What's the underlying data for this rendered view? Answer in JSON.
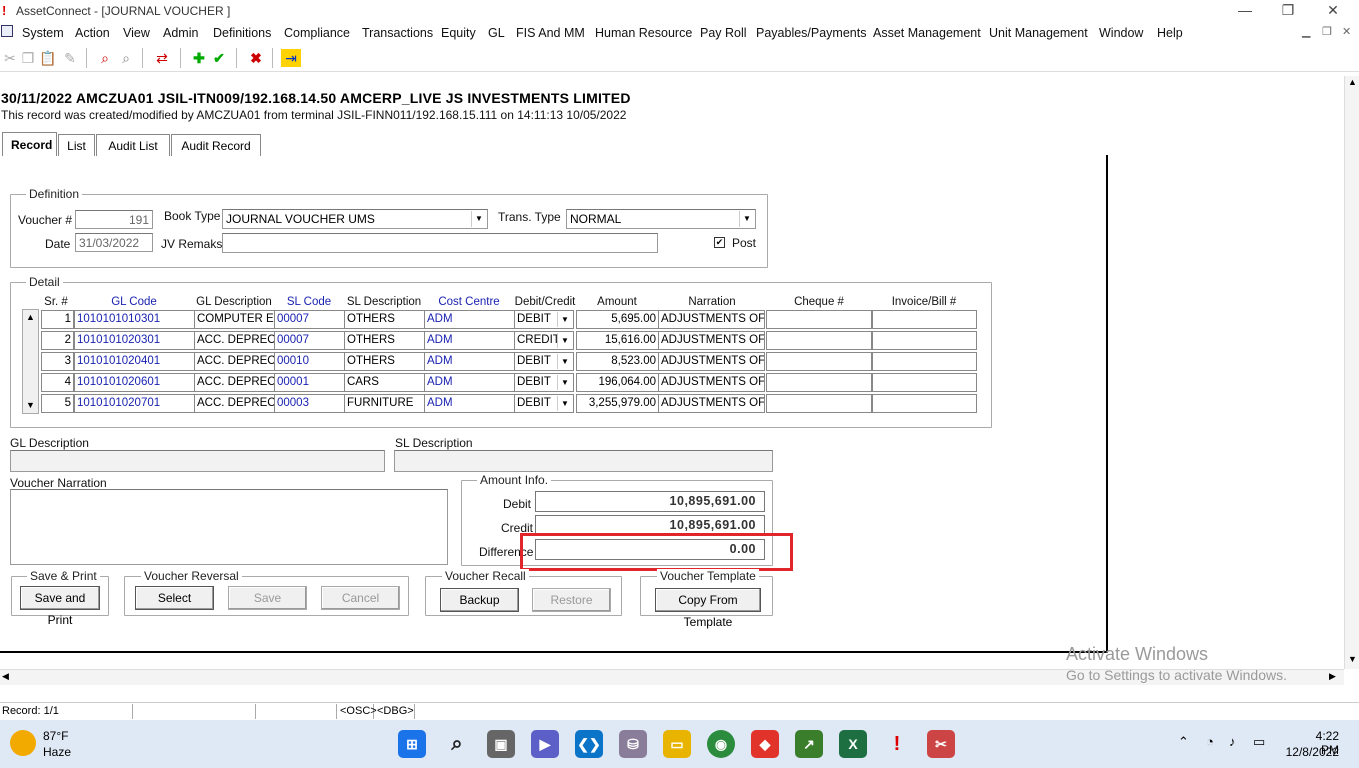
{
  "window": {
    "title": "AssetConnect - [JOURNAL VOUCHER ]"
  },
  "menu": [
    "System",
    "Action",
    "View",
    "Admin",
    "Definitions",
    "Compliance",
    "Transactions",
    "Equity",
    "GL",
    "FIS And MM",
    "Human Resource",
    "Pay Roll",
    "Payables/Payments",
    "Asset Management",
    "Unit Management",
    "Window",
    "Help"
  ],
  "header": {
    "line1": "30/11/2022    AMCZUA01    JSIL-ITN009/192.168.14.50    AMCERP_LIVE    JS INVESTMENTS LIMITED",
    "line2": "This record was created/modified by AMCZUA01 from terminal JSIL-FINN011/192.168.15.111 on 14:11:13 10/05/2022"
  },
  "tabs": [
    "Record",
    "List",
    "Audit List",
    "Audit Record"
  ],
  "definition": {
    "title": "Definition",
    "voucher_label": "Voucher #",
    "voucher_value": "191",
    "book_type_label": "Book Type",
    "book_type_value": "JOURNAL VOUCHER UMS",
    "trans_type_label": "Trans. Type",
    "trans_type_value": "NORMAL",
    "date_label": "Date",
    "date_value": "31/03/2022",
    "jv_remarks_label": "JV Remaks",
    "jv_remarks_value": "",
    "post_label": "Post"
  },
  "detail": {
    "title": "Detail",
    "columns": [
      "Sr. #",
      "GL Code",
      "GL Description",
      "SL Code",
      "SL Description",
      "Cost Centre",
      "Debit/Credit",
      "Amount",
      "Narration",
      "Cheque #",
      "Invoice/Bill #"
    ],
    "rows": [
      {
        "sr": "1",
        "gl": "1010101010301",
        "gld": "COMPUTER E",
        "sl": "00007",
        "sld": "OTHERS",
        "cc": "ADM",
        "dc": "DEBIT",
        "amt": "5,695.00",
        "nar": "ADJUSTMENTS OF",
        "chq": "",
        "inv": ""
      },
      {
        "sr": "2",
        "gl": "1010101020301",
        "gld": "ACC. DEPREC",
        "sl": "00007",
        "sld": "OTHERS",
        "cc": "ADM",
        "dc": "CREDIT",
        "amt": "15,616.00",
        "nar": "ADJUSTMENTS OF",
        "chq": "",
        "inv": ""
      },
      {
        "sr": "3",
        "gl": "1010101020401",
        "gld": "ACC. DEPREC",
        "sl": "00010",
        "sld": "OTHERS",
        "cc": "ADM",
        "dc": "DEBIT",
        "amt": "8,523.00",
        "nar": "ADJUSTMENTS OF",
        "chq": "",
        "inv": ""
      },
      {
        "sr": "4",
        "gl": "1010101020601",
        "gld": "ACC. DEPREC",
        "sl": "00001",
        "sld": "CARS",
        "cc": "ADM",
        "dc": "DEBIT",
        "amt": "196,064.00",
        "nar": "ADJUSTMENTS OF",
        "chq": "",
        "inv": ""
      },
      {
        "sr": "5",
        "gl": "1010101020701",
        "gld": "ACC. DEPREC",
        "sl": "00003",
        "sld": "FURNITURE",
        "cc": "ADM",
        "dc": "DEBIT",
        "amt": "3,255,979.00",
        "nar": "ADJUSTMENTS OF",
        "chq": "",
        "inv": ""
      }
    ]
  },
  "descriptions": {
    "gl_label": "GL Description",
    "sl_label": "SL Description",
    "narration_label": "Voucher Narration"
  },
  "amount_info": {
    "title": "Amount Info.",
    "debit_label": "Debit",
    "debit": "10,895,691.00",
    "credit_label": "Credit",
    "credit": "10,895,691.00",
    "difference_label": "Difference",
    "difference": "0.00"
  },
  "groups": {
    "save_print": {
      "title": "Save & Print",
      "button": "Save and Print"
    },
    "reversal": {
      "title": "Voucher Reversal",
      "select": "Select",
      "save": "Save",
      "cancel": "Cancel"
    },
    "recall": {
      "title": "Voucher Recall",
      "backup": "Backup",
      "restore": "Restore"
    },
    "template": {
      "title": "Voucher Template",
      "copy": "Copy From Template"
    }
  },
  "status": {
    "record": "Record: 1/1",
    "osc": "<OSC>",
    "dbg": "<DBG>"
  },
  "watermark": {
    "line1": "Activate Windows",
    "line2": "Go to Settings to activate Windows."
  },
  "taskbar": {
    "temp": "87°F",
    "weather": "Haze",
    "time": "4:22 PM",
    "date": "12/8/2022"
  },
  "colors": {
    "highlight_box": "#e0262b",
    "blue_text": "#1a23b0"
  }
}
